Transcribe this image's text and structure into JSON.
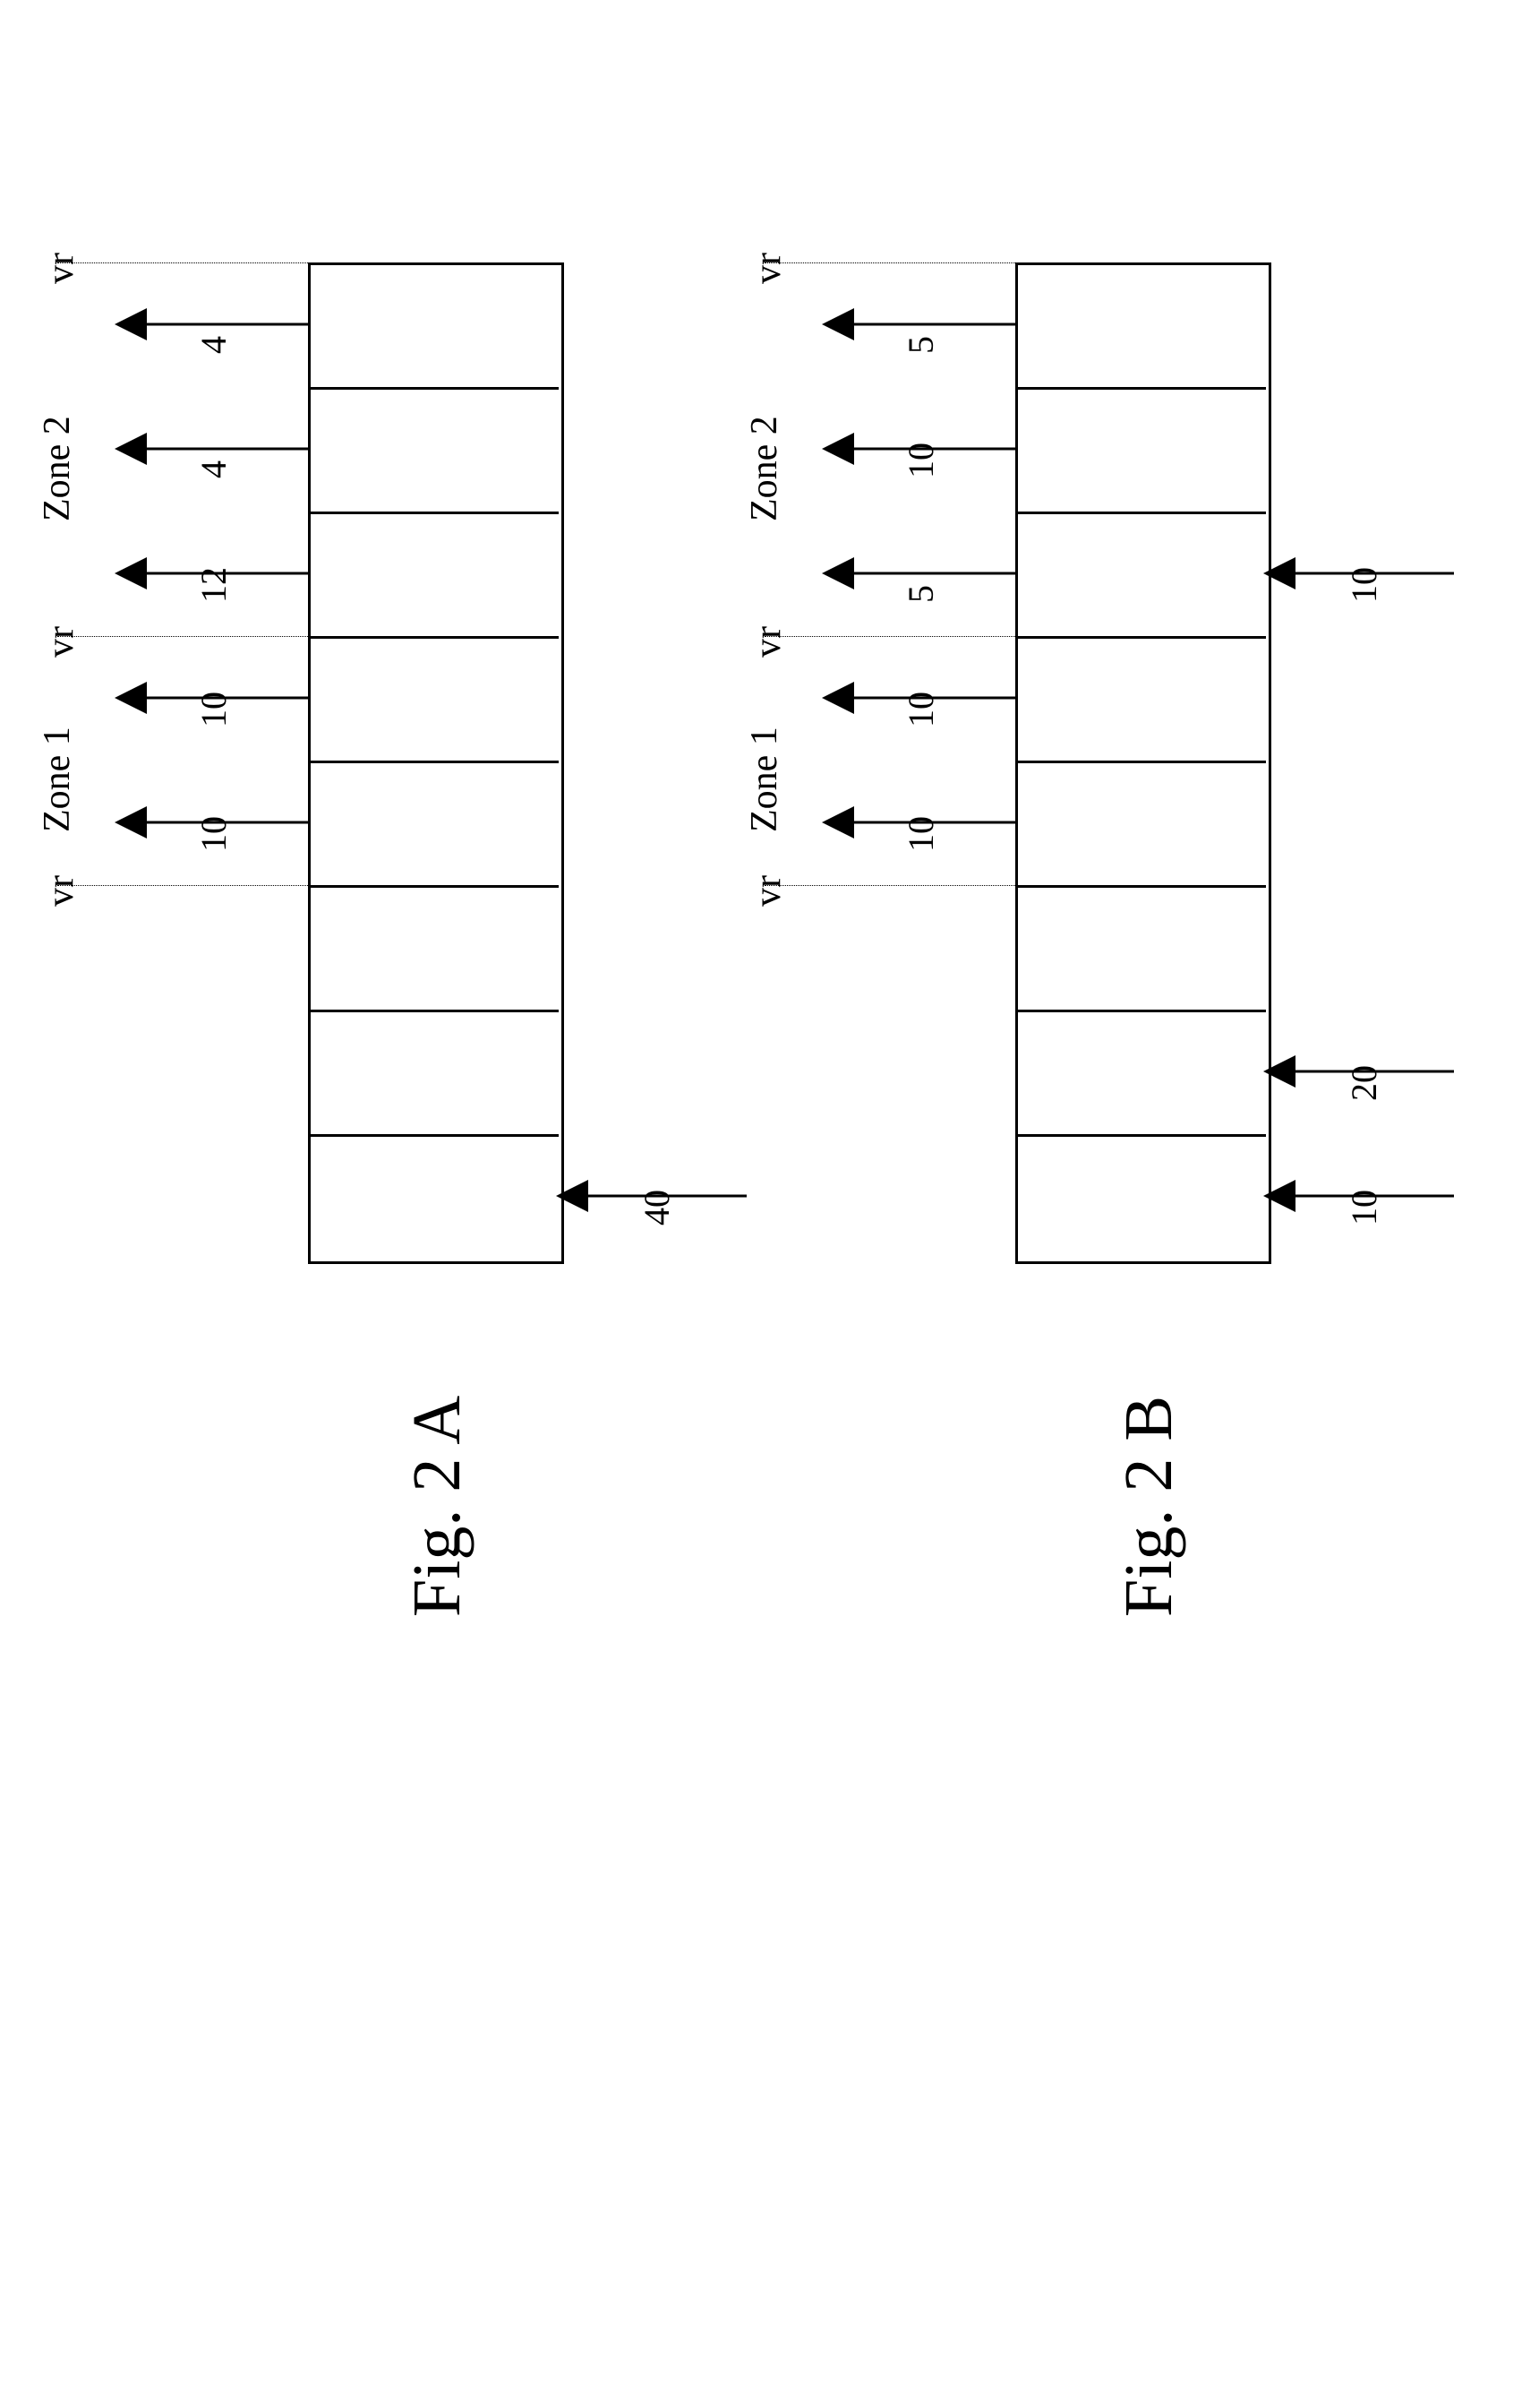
{
  "figA": {
    "caption": "Fig. 2 A",
    "zones": [
      "Zone 1",
      "Zone 2"
    ],
    "vr_label": "vr",
    "left_values": [
      "4",
      "4",
      "12",
      "10",
      "10"
    ],
    "right_in": [
      "40"
    ]
  },
  "figB": {
    "caption": "Fig. 2 B",
    "zones": [
      "Zone 1",
      "Zone 2"
    ],
    "vr_label": "vr",
    "left_values": [
      "5",
      "10",
      "5",
      "10",
      "10"
    ],
    "right_in": [
      "10",
      "20",
      "10"
    ]
  },
  "chart_data": [
    {
      "id": "Fig. 2 A",
      "type": "diagram-column",
      "trays": 8,
      "zones": [
        {
          "name": "Zone 2",
          "left_out": [
            4,
            4,
            12
          ]
        },
        {
          "name": "Zone 1",
          "left_out": [
            10,
            10
          ]
        }
      ],
      "right_in": [
        40
      ]
    },
    {
      "id": "Fig. 2 B",
      "type": "diagram-column",
      "trays": 8,
      "zones": [
        {
          "name": "Zone 2",
          "left_out": [
            5,
            10,
            5
          ]
        },
        {
          "name": "Zone 1",
          "left_out": [
            10,
            10
          ]
        }
      ],
      "right_in": [
        10,
        20,
        10
      ]
    }
  ]
}
